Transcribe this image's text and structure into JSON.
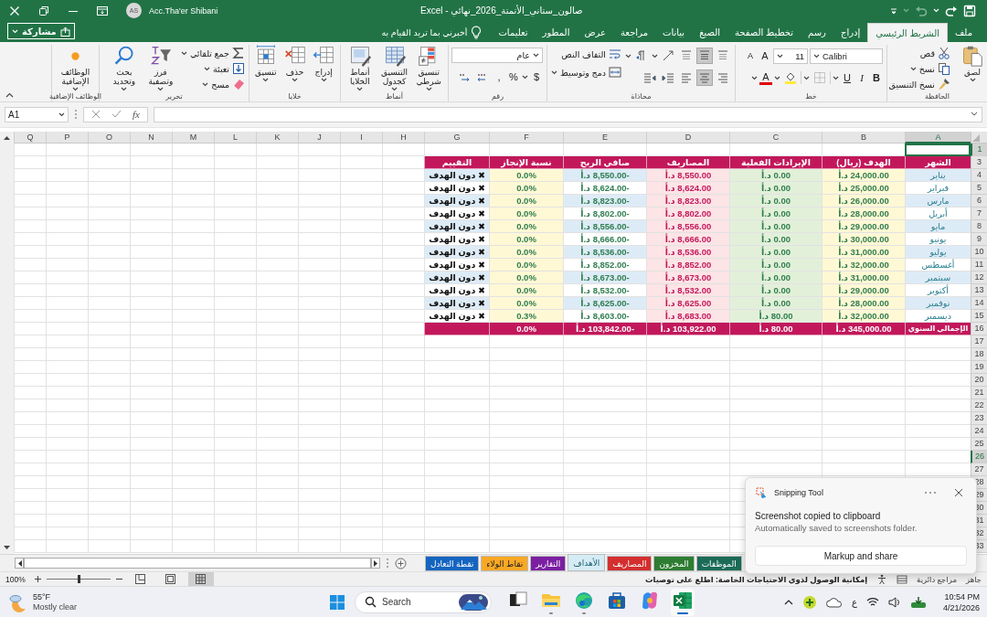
{
  "title_bar": {
    "title": "صالون_ستاني_الأتمتة_2026_نهائي - Excel",
    "user_initials": "AS",
    "user_name": "Acc.Tha'er Shibani"
  },
  "ribbon_tabs": [
    {
      "label": "ملف",
      "selected": false
    },
    {
      "label": "الشريط الرئيسي",
      "selected": true
    },
    {
      "label": "إدراج",
      "selected": false
    },
    {
      "label": "رسم",
      "selected": false
    },
    {
      "label": "تخطيط الصفحة",
      "selected": false
    },
    {
      "label": "الصيغ",
      "selected": false
    },
    {
      "label": "بيانات",
      "selected": false
    },
    {
      "label": "مراجعة",
      "selected": false
    },
    {
      "label": "عرض",
      "selected": false
    },
    {
      "label": "المطور",
      "selected": false
    },
    {
      "label": "تعليمات",
      "selected": false
    }
  ],
  "tell_me": {
    "placeholder": "أخبرني بما تريد القيام به"
  },
  "share_button": "مشاركة",
  "ribbon_groups": [
    {
      "kind": "clipboard",
      "label": "الحافظة",
      "items": [
        "لصق",
        "قص",
        "نسخ",
        "نسخ التنسيق"
      ]
    },
    {
      "kind": "font",
      "label": "خط",
      "font_name": "Calibri",
      "font_size": "11",
      "grow_font": "A",
      "shrink_font": "A",
      "font_color": "A",
      "items": [
        "B",
        "I",
        "U"
      ]
    },
    {
      "kind": "alignment",
      "label": "محاذاة",
      "items": [
        "التفاف النص",
        "دمج وتوسيط"
      ],
      "vertical_align": [
        {
          "selected": false
        },
        {
          "selected": true
        },
        {
          "selected": false
        }
      ],
      "horizontal_align": [
        {
          "selected": false
        },
        {
          "selected": true
        },
        {
          "selected": false
        }
      ]
    },
    {
      "kind": "number",
      "label": "رقم",
      "format": "عام",
      "items": [
        "$",
        "%",
        ","
      ]
    },
    {
      "kind": "large_buttons",
      "label": "أنماط",
      "items": [
        "تنسيق شرطي",
        "التنسيق كجدول",
        "أنماط الخلايا"
      ]
    },
    {
      "kind": "large_buttons",
      "label": "خلايا",
      "items": [
        "إدراج",
        "حذف",
        "تنسيق"
      ]
    },
    {
      "kind": "editing",
      "label": "تحرير",
      "items": [
        "جمع تلقائي",
        "تعبئة",
        "مسح",
        "فرز وتصفية",
        "بحث وتحديد"
      ]
    },
    {
      "kind": "large_buttons",
      "label": "الوظائف الإضافية",
      "items": [
        "الوظائف الإضافية"
      ]
    }
  ],
  "formula_bar": {
    "name_box": "A1",
    "function_button": "fx"
  },
  "sheet": {
    "columns": [
      {
        "label": "A",
        "selected": true
      },
      {
        "label": "B",
        "selected": false
      },
      {
        "label": "C",
        "selected": false
      },
      {
        "label": "D",
        "selected": false
      },
      {
        "label": "E",
        "selected": false
      },
      {
        "label": "F",
        "selected": false
      },
      {
        "label": "G",
        "selected": false
      },
      {
        "label": "H",
        "selected": false
      },
      {
        "label": "I",
        "selected": false
      },
      {
        "label": "J",
        "selected": false
      },
      {
        "label": "K",
        "selected": false
      },
      {
        "label": "L",
        "selected": false
      },
      {
        "label": "M",
        "selected": false
      },
      {
        "label": "N",
        "selected": false
      },
      {
        "label": "O",
        "selected": false
      },
      {
        "label": "P",
        "selected": false
      },
      {
        "label": "Q",
        "selected": false
      }
    ],
    "rows": [
      {
        "label": "1",
        "selected": true
      },
      {
        "label": "3",
        "selected": false,
        "kind": "header",
        "cells": [
          "الشهر",
          "الهدف (ريال)",
          "الإيرادات الفعلية",
          "المصاريف",
          "صافي الربح",
          "نسبة الإنجاز",
          "التقييم"
        ]
      },
      {
        "label": "4",
        "selected": false,
        "kind": "data",
        "cells": [
          "يناير",
          "24,000.00 د.أ",
          "0.00 د.أ",
          "8,550.00 د.أ",
          "-8,550.00 د.أ",
          "0.0%",
          "✖ دون الهدف"
        ]
      },
      {
        "label": "5",
        "selected": false,
        "kind": "data",
        "cells": [
          "فبراير",
          "25,000.00 د.أ",
          "0.00 د.أ",
          "8,624.00 د.أ",
          "-8,624.00 د.أ",
          "0.0%",
          "✖ دون الهدف"
        ]
      },
      {
        "label": "6",
        "selected": false,
        "kind": "data",
        "cells": [
          "مارس",
          "26,000.00 د.أ",
          "0.00 د.أ",
          "8,823.00 د.أ",
          "-8,823.00 د.أ",
          "0.0%",
          "✖ دون الهدف"
        ]
      },
      {
        "label": "7",
        "selected": false,
        "kind": "data",
        "cells": [
          "أبريل",
          "28,000.00 د.أ",
          "0.00 د.أ",
          "8,802.00 د.أ",
          "-8,802.00 د.أ",
          "0.0%",
          "✖ دون الهدف"
        ]
      },
      {
        "label": "8",
        "selected": false,
        "kind": "data",
        "cells": [
          "مايو",
          "29,000.00 د.أ",
          "0.00 د.أ",
          "8,556.00 د.أ",
          "-8,556.00 د.أ",
          "0.0%",
          "✖ دون الهدف"
        ]
      },
      {
        "label": "9",
        "selected": false,
        "kind": "data",
        "cells": [
          "يونيو",
          "30,000.00 د.أ",
          "0.00 د.أ",
          "8,666.00 د.أ",
          "-8,666.00 د.أ",
          "0.0%",
          "✖ دون الهدف"
        ]
      },
      {
        "label": "10",
        "selected": false,
        "kind": "data",
        "cells": [
          "يوليو",
          "31,000.00 د.أ",
          "0.00 د.أ",
          "8,536.00 د.أ",
          "-8,536.00 د.أ",
          "0.0%",
          "✖ دون الهدف"
        ]
      },
      {
        "label": "11",
        "selected": false,
        "kind": "data",
        "cells": [
          "أغسطس",
          "32,000.00 د.أ",
          "0.00 د.أ",
          "8,852.00 د.أ",
          "-8,852.00 د.أ",
          "0.0%",
          "✖ دون الهدف"
        ]
      },
      {
        "label": "12",
        "selected": false,
        "kind": "data",
        "cells": [
          "سبتمبر",
          "31,000.00 د.أ",
          "0.00 د.أ",
          "8,673.00 د.أ",
          "-8,673.00 د.أ",
          "0.0%",
          "✖ دون الهدف"
        ]
      },
      {
        "label": "13",
        "selected": false,
        "kind": "data",
        "cells": [
          "أكتوبر",
          "29,000.00 د.أ",
          "0.00 د.أ",
          "8,532.00 د.أ",
          "-8,532.00 د.أ",
          "0.0%",
          "✖ دون الهدف"
        ]
      },
      {
        "label": "14",
        "selected": false,
        "kind": "data",
        "cells": [
          "نوفمبر",
          "28,000.00 د.أ",
          "0.00 د.أ",
          "8,625.00 د.أ",
          "-8,625.00 د.أ",
          "0.0%",
          "✖ دون الهدف"
        ]
      },
      {
        "label": "15",
        "selected": false,
        "kind": "data",
        "cells": [
          "ديسمبر",
          "32,000.00 د.أ",
          "80.00 د.أ",
          "8,683.00 د.أ",
          "-8,603.00 د.أ",
          "0.3%",
          "✖ دون الهدف"
        ]
      },
      {
        "label": "16",
        "selected": false,
        "kind": "total",
        "cells": [
          "الإجمالي السنوي",
          "345,000.00 د.أ",
          "80.00 د.أ",
          "103,922.00 د.أ",
          "-103,842.00 د.أ",
          "0.0%"
        ]
      },
      {
        "label": "17",
        "selected": false
      },
      {
        "label": "18",
        "selected": false
      },
      {
        "label": "19",
        "selected": false
      },
      {
        "label": "20",
        "selected": false
      },
      {
        "label": "21",
        "selected": false
      },
      {
        "label": "22",
        "selected": false
      },
      {
        "label": "23",
        "selected": false
      },
      {
        "label": "24",
        "selected": false
      },
      {
        "label": "25",
        "selected": false
      },
      {
        "label": "26",
        "selected": true
      },
      {
        "label": "27",
        "selected": false
      },
      {
        "label": "28",
        "selected": false
      },
      {
        "label": "29",
        "selected": false
      },
      {
        "label": "30",
        "selected": false
      },
      {
        "label": "31",
        "selected": false
      },
      {
        "label": "32",
        "selected": false
      },
      {
        "label": "33",
        "selected": false
      }
    ]
  },
  "sheet_tabs": [
    {
      "label": "الموظفات",
      "color": "#1b6b57",
      "selected": false
    },
    {
      "label": "المخزون",
      "color": "#2e7d32",
      "selected": false
    },
    {
      "label": "المصاريف",
      "color": "#d32f2f",
      "selected": false
    },
    {
      "label": "الأهداف",
      "color": "#d6ecf5",
      "selected": true
    },
    {
      "label": "التقارير",
      "color": "#7b1fa2",
      "selected": false
    },
    {
      "label": "نقاط الولاء",
      "color": "#f9a825",
      "selected": false
    },
    {
      "label": "نقطة التعادل",
      "color": "#1565c0",
      "selected": false
    }
  ],
  "status_bar": {
    "ready": "جاهز",
    "circular_refs": "مراجع دائرية",
    "accessibility": "إمكانية الوصول لذوي الاحتياجات الخاصة: اطلع على توصيات",
    "zoom": "100%",
    "zoom_slider": {
      "level": 0.5
    },
    "views": [
      {
        "selected": false
      },
      {
        "selected": false
      },
      {
        "selected": true
      }
    ]
  },
  "notification": {
    "app": "Snipping Tool",
    "title": "Screenshot copied to clipboard",
    "body": "Automatically saved to screenshots folder.",
    "button": "Markup and share"
  },
  "taskbar": {
    "weather": {
      "temperature": "55°F",
      "condition": "Mostly clear"
    },
    "search": {
      "placeholder": "Search"
    },
    "apps": [
      {
        "open": false,
        "selected": false
      },
      {
        "open": true,
        "selected": false
      },
      {
        "open": true,
        "selected": false
      },
      {
        "open": false,
        "selected": false
      },
      {
        "open": false,
        "selected": false
      },
      {
        "open": true,
        "selected": true
      }
    ],
    "input_language": "ع",
    "time": "10:54 PM",
    "date": "4/21/2026"
  }
}
